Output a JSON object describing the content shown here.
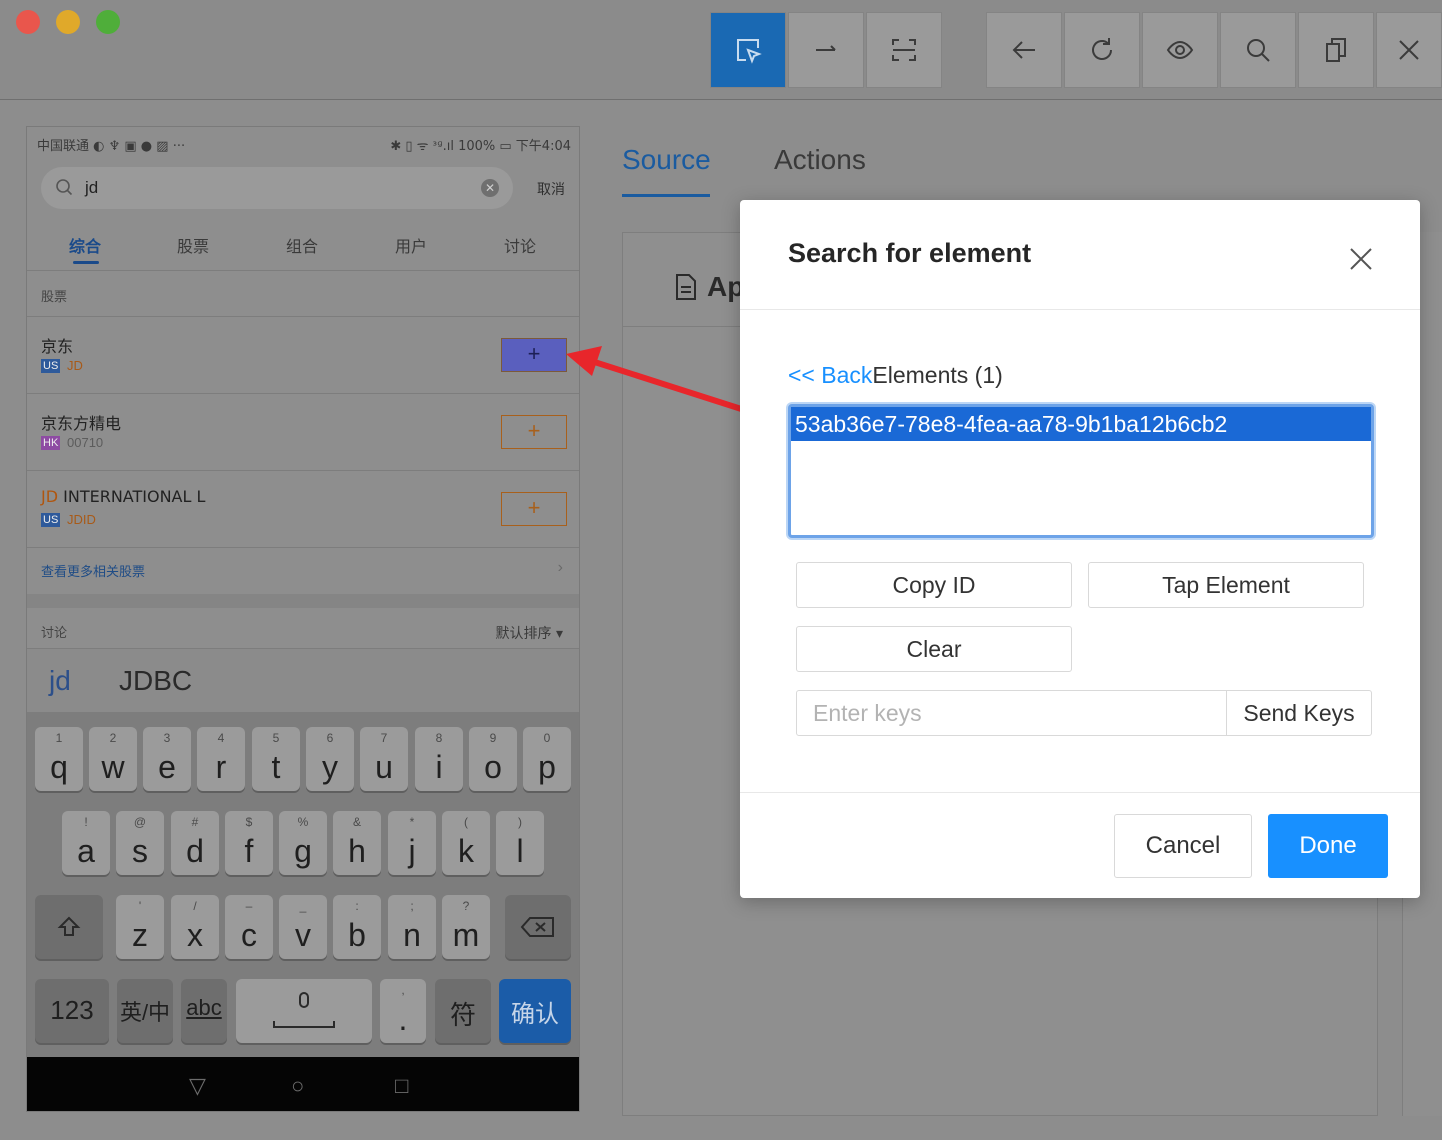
{
  "toolbar": {
    "buttons": [
      "select-element",
      "swipe",
      "screenshot-area",
      "back",
      "refresh",
      "show-hide",
      "search",
      "copy-xml",
      "quit"
    ]
  },
  "phone": {
    "status_left": "中国联通 ◐ ♆ ▣ ● ▨ ···",
    "status_right": "✱ ▯ ᯤ ᶟᶢ.ıl 100% ▭ 下午4:04",
    "search_query": "jd",
    "cancel": "取消",
    "tabs": [
      "综合",
      "股票",
      "组合",
      "用户",
      "讨论"
    ],
    "section_stocks": "股票",
    "stocks": [
      {
        "name": "京东",
        "name_hl": "",
        "market": "US",
        "code": "JD",
        "code_hl": true
      },
      {
        "name": "京东方精电",
        "name_hl": "",
        "market": "HK",
        "code": "00710",
        "code_hl": false
      },
      {
        "name": " INTERNATIONAL L",
        "name_hl": "JD",
        "market": "US",
        "code": "JDID",
        "code_hl": true
      }
    ],
    "add_symbol": "+",
    "more_stocks": "查看更多相关股票",
    "section_discuss": "讨论",
    "sort": "默认排序 ▾",
    "suggestions": [
      "jd",
      "JDBC"
    ],
    "keyboard": {
      "row1": [
        [
          "1",
          "q"
        ],
        [
          "2",
          "w"
        ],
        [
          "3",
          "e"
        ],
        [
          "4",
          "r"
        ],
        [
          "5",
          "t"
        ],
        [
          "6",
          "y"
        ],
        [
          "7",
          "u"
        ],
        [
          "8",
          "i"
        ],
        [
          "9",
          "o"
        ],
        [
          "0",
          "p"
        ]
      ],
      "row2": [
        [
          "!",
          "a"
        ],
        [
          "@",
          "s"
        ],
        [
          "#",
          "d"
        ],
        [
          "$",
          "f"
        ],
        [
          "%",
          "g"
        ],
        [
          "&",
          "h"
        ],
        [
          "*",
          "j"
        ],
        [
          "(",
          "k"
        ],
        [
          ")",
          "l"
        ]
      ],
      "row3": [
        [
          "'",
          "z"
        ],
        [
          "/",
          "x"
        ],
        [
          "–",
          "c"
        ],
        [
          "_",
          "v"
        ],
        [
          ":",
          "b"
        ],
        [
          ";",
          "n"
        ],
        [
          "?",
          "m"
        ]
      ],
      "num": "123",
      "lang": "英/中",
      "abc": "abc",
      "comma_sub": ",",
      "period": ".",
      "symbols": "符",
      "confirm": "确认"
    }
  },
  "inspector": {
    "tabs": [
      "Source",
      "Actions"
    ],
    "panel_title": "Ap"
  },
  "modal": {
    "title": "Search for element",
    "back_link": "<< Back",
    "elements_label": "Elements (1)",
    "elements": [
      "53ab36e7-78e8-4fea-aa78-9b1ba12b6cb2"
    ],
    "copy_id": "Copy ID",
    "tap_element": "Tap Element",
    "clear": "Clear",
    "keys_placeholder": "Enter keys",
    "send_keys": "Send Keys",
    "cancel": "Cancel",
    "done": "Done"
  },
  "colors": {
    "accent": "#1890ff",
    "selected_row": "#1a69d6",
    "arrow": "#e8262b"
  }
}
